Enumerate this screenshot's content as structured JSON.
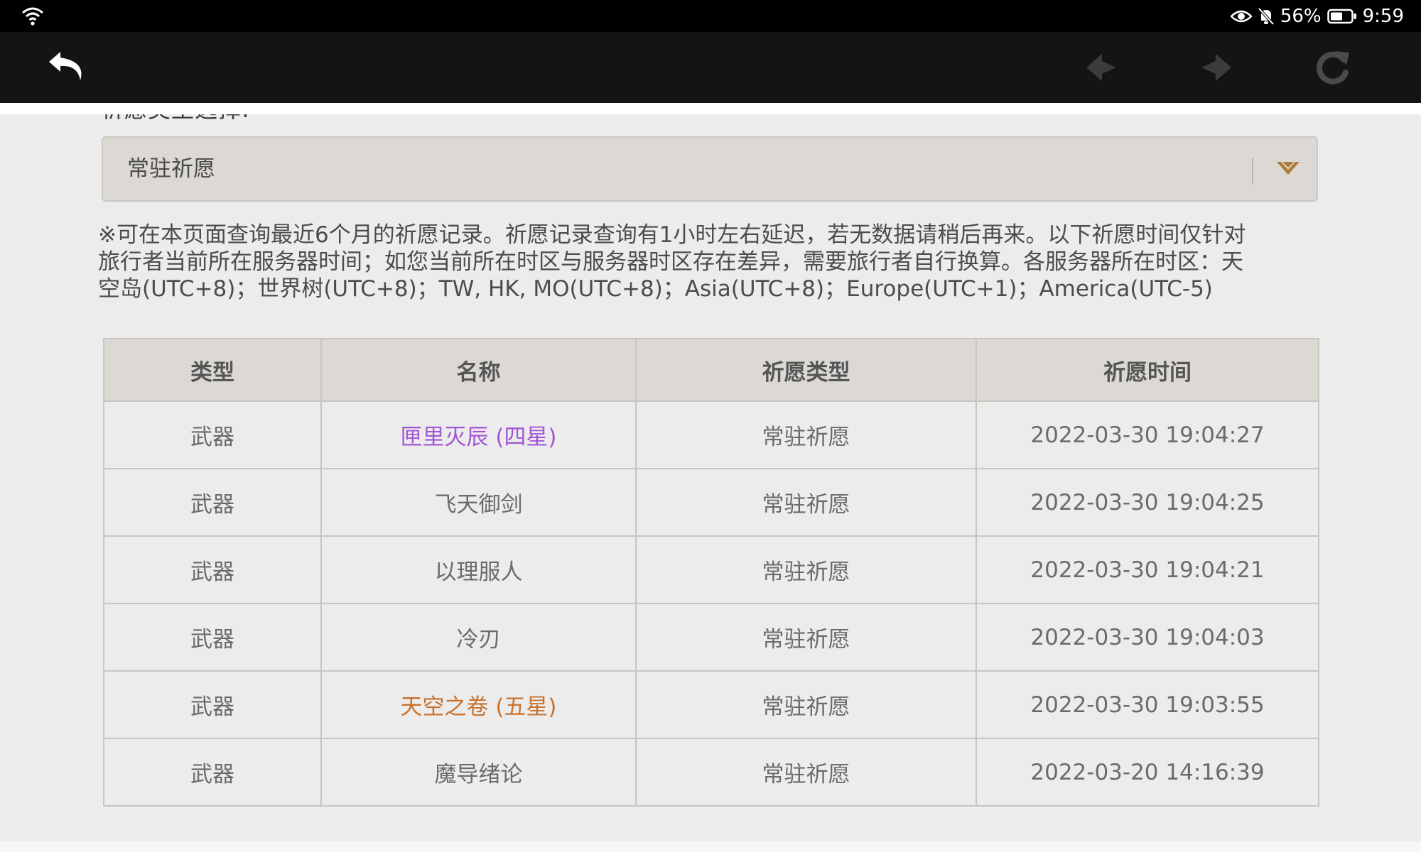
{
  "status_bar": {
    "battery_percent": "56%",
    "time": "9:59",
    "icons": [
      "wifi-icon",
      "eye-icon",
      "bell-muted-icon",
      "battery-icon"
    ]
  },
  "nav": {
    "icons": [
      "back-arrow-icon",
      "prev-arrow-icon",
      "next-arrow-icon",
      "reload-icon"
    ]
  },
  "form": {
    "partial_label": "祈愿类型选择:",
    "select_value": "常驻祈愿"
  },
  "notice": {
    "line1": "※可在本页面查询最近6个月的祈愿记录。祈愿记录查询有1小时左右延迟，若无数据请稍后再来。以下祈愿时间仅针对",
    "line2": "旅行者当前所在服务器时间；如您当前所在时区与服务器时区存在差异，需要旅行者自行换算。各服务器所在时区：天",
    "line3": "空岛(UTC+8)；世界树(UTC+8)；TW, HK, MO(UTC+8)；Asia(UTC+8)；Europe(UTC+1)；America(UTC-5)"
  },
  "table": {
    "headers": [
      "类型",
      "名称",
      "祈愿类型",
      "祈愿时间"
    ],
    "rows": [
      {
        "type": "武器",
        "name": "匣里灭辰 (四星)",
        "wish_type": "常驻祈愿",
        "time": "2022-03-30 19:04:27"
      },
      {
        "type": "武器",
        "name": "飞天御剑",
        "wish_type": "常驻祈愿",
        "time": "2022-03-30 19:04:25"
      },
      {
        "type": "武器",
        "name": "以理服人",
        "wish_type": "常驻祈愿",
        "time": "2022-03-30 19:04:21"
      },
      {
        "type": "武器",
        "name": "冷刃",
        "wish_type": "常驻祈愿",
        "time": "2022-03-30 19:04:03"
      },
      {
        "type": "武器",
        "name": "天空之卷 (五星)",
        "wish_type": "常驻祈愿",
        "time": "2022-03-30 19:03:55"
      },
      {
        "type": "武器",
        "name": "魔导绪论",
        "wish_type": "常驻祈愿",
        "time": "2022-03-20 14:16:39"
      }
    ]
  },
  "colors": {
    "four_star": "#a256d6",
    "five_star": "#c9722d",
    "normal_text": "#6b6b6b"
  }
}
